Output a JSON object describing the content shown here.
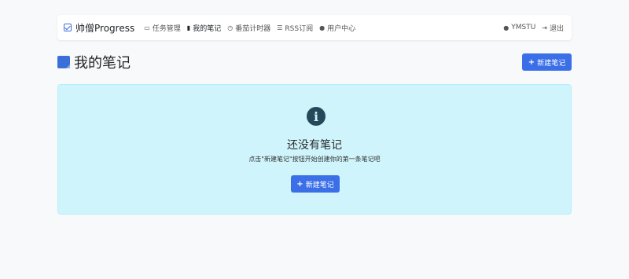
{
  "navbar": {
    "brand": "帅僧Progress",
    "items": [
      {
        "icon": "▭",
        "label": "任务管理",
        "active": false
      },
      {
        "icon": "▮",
        "label": "我的笔记",
        "active": true
      },
      {
        "icon": "◷",
        "label": "番茄计时器",
        "active": false
      },
      {
        "icon": "☰",
        "label": "RSS订阅",
        "active": false
      },
      {
        "icon": "●",
        "label": "用户中心",
        "active": false
      }
    ],
    "user": {
      "icon": "●",
      "label": "YMSTU"
    },
    "logout": {
      "icon": "⇥",
      "label": "退出"
    }
  },
  "page": {
    "title": "我的笔记",
    "new_button": "新建笔记"
  },
  "empty_state": {
    "icon": "i",
    "title": "还没有笔记",
    "subtitle": "点击\"新建笔记\"按钮开始创建你的第一条笔记吧",
    "button": "新建笔记"
  },
  "colors": {
    "primary": "#3b6fe8",
    "info_bg": "#cff4fc",
    "info_icon": "#23495a",
    "page_bg": "#f8f9fa"
  }
}
